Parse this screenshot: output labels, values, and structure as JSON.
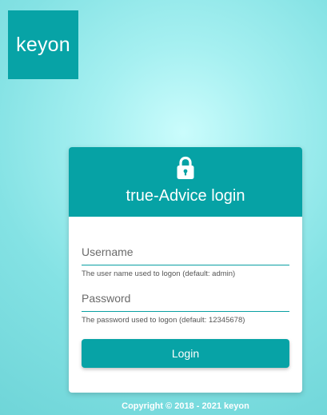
{
  "brand": {
    "logo_text": "keyon"
  },
  "login": {
    "title": "true-Advice login",
    "icon": "lock-icon",
    "username": {
      "value": "",
      "placeholder": "Username",
      "hint": "The user name used to logon (default: admin)"
    },
    "password": {
      "value": "",
      "placeholder": "Password",
      "hint": "The password used to logon (default: 12345678)"
    },
    "button_label": "Login"
  },
  "footer": {
    "copyright": "Copyright © 2018 - 2021 keyon"
  },
  "colors": {
    "primary": "#07a3a6",
    "background": "#84e2e4",
    "text_on_primary": "#ffffff"
  }
}
